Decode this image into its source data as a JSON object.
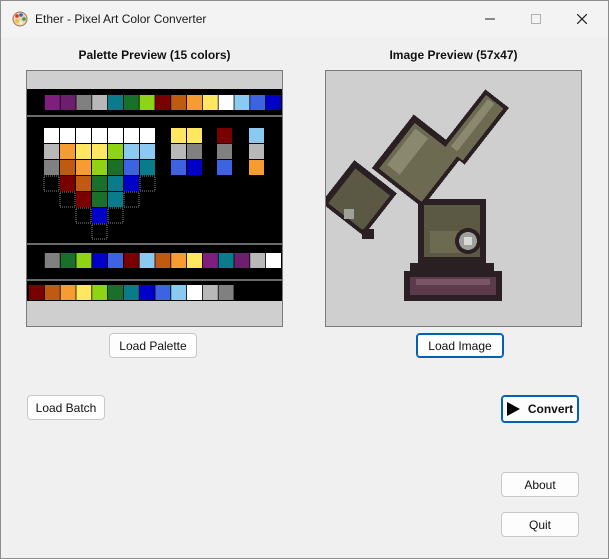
{
  "window": {
    "title": "Ether - Pixel Art Color Converter"
  },
  "palette_panel": {
    "title": "Palette Preview (15 colors)"
  },
  "image_panel": {
    "title": "Image Preview (57x47)"
  },
  "buttons": {
    "load_palette": "Load Palette",
    "load_image": "Load Image",
    "load_batch": "Load Batch",
    "convert": "Convert",
    "about": "About",
    "quit": "Quit"
  },
  "palette_colors": [
    "#000000",
    "#7e1f7e",
    "#6d1f6d",
    "#808080",
    "#b8b8b8",
    "#0a7b8a",
    "#1a6f2a",
    "#8ed314",
    "#7a0000",
    "#c05a10",
    "#f79c31",
    "#ffe860",
    "#ffffff",
    "#8ac9f0",
    "#3e63e0",
    "#0000c8"
  ]
}
